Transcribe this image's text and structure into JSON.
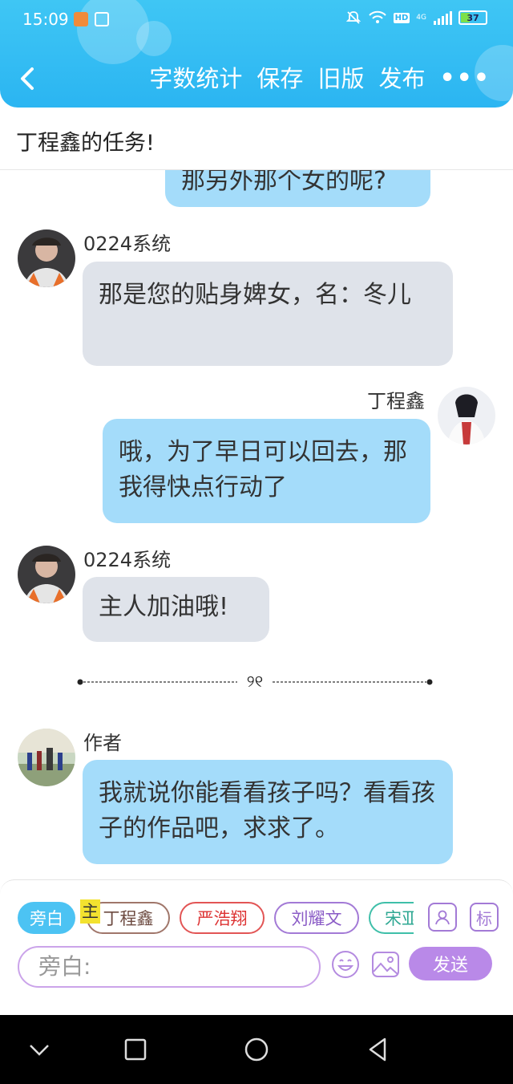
{
  "status_bar": {
    "time": "15:09",
    "hd": "HD",
    "network": "4G",
    "battery": "37",
    "battery_level": 0.37
  },
  "header": {
    "back_icon": "chevron-left-icon",
    "actions": [
      "字数统计",
      "保存",
      "旧版",
      "发布"
    ],
    "more": "•••"
  },
  "title": "丁程鑫的任务!",
  "messages": [
    {
      "side": "right",
      "sender": "",
      "text": "那另外那个女的呢?",
      "partial": true
    },
    {
      "side": "left",
      "sender": "0224系统",
      "text": "那是您的贴身婢女，名：冬儿"
    },
    {
      "side": "right",
      "sender": "丁程鑫",
      "text": "哦，为了早日可以回去，那我得快点行动了"
    },
    {
      "side": "left",
      "sender": "0224系统",
      "text": "主人加油哦!"
    },
    {
      "side": "left",
      "sender": "作者",
      "text": "我就说你能看看孩子吗？看看孩子的作品吧，求求了。"
    }
  ],
  "divider_text": "୨୧",
  "composer": {
    "narration_chip": "旁白",
    "main_tag": "主",
    "roles": [
      "丁程鑫",
      "严浩翔",
      "刘耀文",
      "宋亚"
    ],
    "avatar_button_icon": "person-icon",
    "tag_button": "标",
    "input_placeholder": "旁白:",
    "emoji_icon": "smiley-icon",
    "image_icon": "image-icon",
    "send": "发送"
  },
  "colors": {
    "header": "#2bb5f2",
    "bubble_left": "#dfe3ea",
    "bubble_right": "#a4dcfa",
    "send": "#b989e8",
    "accent_purple": "#a37ad6"
  }
}
